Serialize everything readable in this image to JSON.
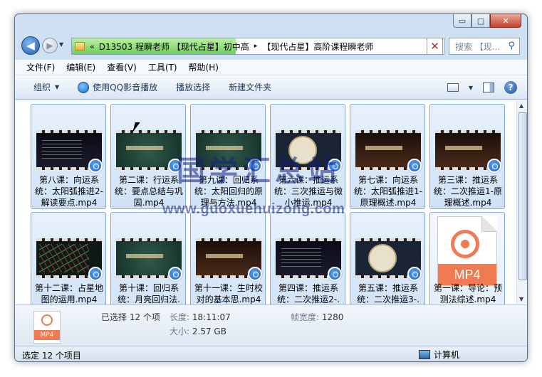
{
  "window": {
    "caption": {
      "min_glyph": "▭",
      "max_glyph": "▢",
      "close_glyph": "✕"
    }
  },
  "nav": {
    "back_glyph": "◀",
    "forward_glyph": "▶",
    "address": {
      "overflow": "«",
      "crumbs": [
        "D13503 程瞬老师 【现代占星】初中高",
        "【现代占星】高阶课程瞬老师"
      ],
      "separator": "▸"
    },
    "search_placeholder": "搜索 【现...",
    "stop_glyph": "✕"
  },
  "menu": [
    "文件(F)",
    "编辑(E)",
    "查看(V)",
    "工具(T)",
    "帮助(H)"
  ],
  "toolbar": {
    "organize": "组织",
    "play_qq": "使用QQ影音播放",
    "play_select": "播放选择",
    "new_folder": "新建文件夹",
    "help": "?"
  },
  "files": [
    {
      "label": "第八课：向运系统：太阳弧推进2- 解读要点.mp4",
      "scene": "dark-text"
    },
    {
      "label": "第二课：行运系统：要点总结与巩固.mp4",
      "scene": "green-title"
    },
    {
      "label": "第九课：回归系统：太阳回归的原理与方法.mp4",
      "scene": "green-title"
    },
    {
      "label": "第六课：推运系统：三次推运与微小推运.mp4",
      "scene": "chart-wheel"
    },
    {
      "label": "第七课：向运系统：太阳弧推进1- 原理概述.mp4",
      "scene": "dark-title"
    },
    {
      "label": "第三课：推运系统：二次推运1-原理概述.mp4",
      "scene": "dark-title"
    },
    {
      "label": "第十二课：占星地图的运用.mp4",
      "scene": "map-lines"
    },
    {
      "label": "第十课：回归系统：月亮回归法.mp4",
      "scene": "green-title"
    },
    {
      "label": "第十一课：生时校对的基本思.mp4",
      "scene": "dark-title"
    },
    {
      "label": "第四课：推运系统：二次推运2-.mp4",
      "scene": "dark-text"
    },
    {
      "label": "第五课：推运系统：二次推运3-.mp4",
      "scene": "chart-wheel"
    },
    {
      "label": "第一课：导论：预测法综述.mp4",
      "scene": "mp4-icon"
    }
  ],
  "mp4_icon_text": "MP4",
  "details": {
    "selected": "已选择 12 个项",
    "length_key": "长度:",
    "length_val": "18:11:07",
    "size_key": "大小:",
    "size_val": "2.57 GB",
    "fw_key": "帧宽度:",
    "fw_val": "1280",
    "icon_text": "MP4"
  },
  "status": {
    "left": "选定 12 个项目",
    "right": "计算机"
  },
  "watermark": {
    "text": "国学汇总站",
    "url": "www.guoxuehuizong.com"
  },
  "colors": {
    "accent": "#f07a52",
    "window_frame": "#cfe0f2",
    "tile_border": "#84acdd"
  }
}
